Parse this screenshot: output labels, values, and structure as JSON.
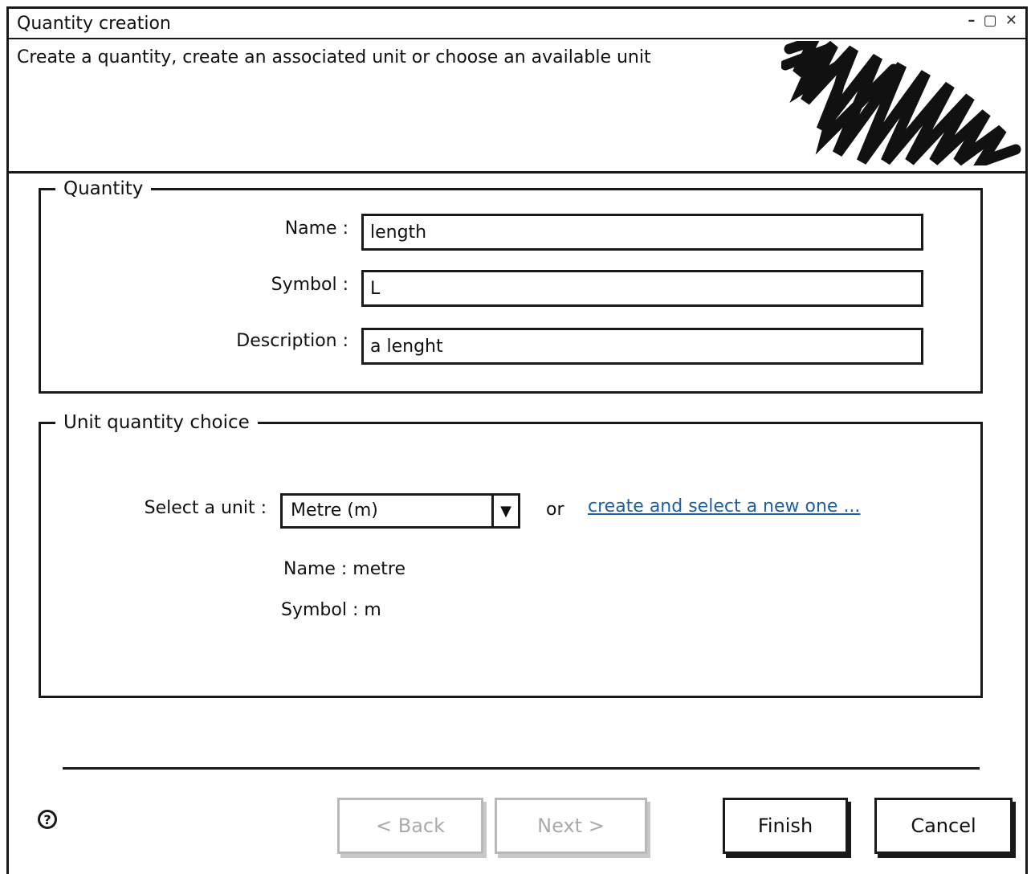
{
  "window": {
    "title": "Quantity creation",
    "controls": "– ▢ ✕"
  },
  "header": {
    "text": "Create a quantity, create an associated unit or choose an available unit"
  },
  "quantity": {
    "legend": "Quantity",
    "name_label": "Name :",
    "name_value": "length",
    "symbol_label": "Symbol :",
    "symbol_value": "L",
    "description_label": "Description :",
    "description_value": "a lenght"
  },
  "unit_choice": {
    "legend": "Unit quantity choice",
    "select_label": "Select a unit :",
    "selected_unit": "Metre (m)",
    "or_text": "or",
    "create_link": "create and select a new one ...",
    "name_info": "Name : metre",
    "symbol_info": "Symbol : m"
  },
  "footer": {
    "help_icon": "?",
    "back_label": "< Back",
    "next_label": "Next >",
    "finish_label": "Finish",
    "cancel_label": "Cancel"
  },
  "colors": {
    "border": "#1a1a1a",
    "link": "#1f5fa8",
    "disabled": "#aaaaaa"
  }
}
